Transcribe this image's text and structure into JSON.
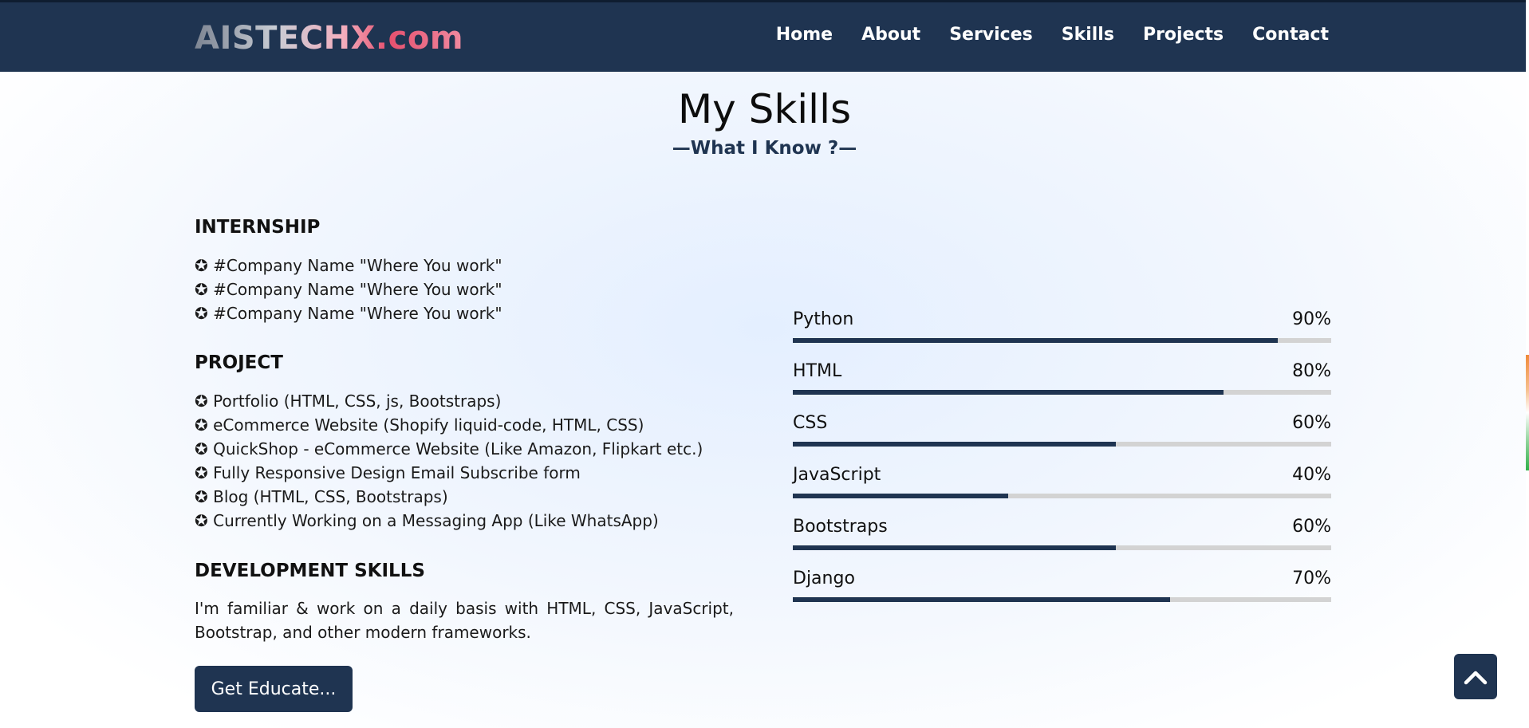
{
  "nav": {
    "logo": "AISTECHX.com",
    "links": [
      "Home",
      "About",
      "Services",
      "Skills",
      "Projects",
      "Contact"
    ]
  },
  "header": {
    "title": "My Skills",
    "subtitle": "—What I Know ?—"
  },
  "internship": {
    "heading": "INTERNSHIP",
    "items": [
      "✪ #Company Name \"Where You work\"",
      "✪ #Company Name \"Where You work\"",
      "✪ #Company Name \"Where You work\""
    ]
  },
  "project": {
    "heading": "PROJECT",
    "items": [
      "✪ Portfolio (HTML, CSS, js, Bootstraps)",
      "✪ eCommerce Website (Shopify liquid-code, HTML, CSS)",
      "✪ QuickShop - eCommerce Website (Like Amazon, Flipkart etc.)",
      "✪ Fully Responsive Design Email Subscribe form",
      "✪ Blog (HTML, CSS, Bootstraps)",
      "✪ Currently Working on a Messaging App (Like WhatsApp)"
    ]
  },
  "development": {
    "heading": "DEVELOPMENT SKILLS",
    "text": "I'm familiar & work on a daily basis with HTML, CSS, JavaScript, Bootstrap, and other modern frameworks.",
    "button_label": "Get Educate..."
  },
  "skills": [
    {
      "name": "Python",
      "percent_label": "90%",
      "value": 90
    },
    {
      "name": "HTML",
      "percent_label": "80%",
      "value": 80
    },
    {
      "name": "CSS",
      "percent_label": "60%",
      "value": 60
    },
    {
      "name": "JavaScript",
      "percent_label": "40%",
      "value": 40
    },
    {
      "name": "Bootstraps",
      "percent_label": "60%",
      "value": 60
    },
    {
      "name": "Django",
      "percent_label": "70%",
      "value": 70
    }
  ],
  "scroll_top": {
    "icon": "chevron-up-icon"
  },
  "colors": {
    "primary": "#1f3451",
    "track": "#d3d3d3"
  }
}
